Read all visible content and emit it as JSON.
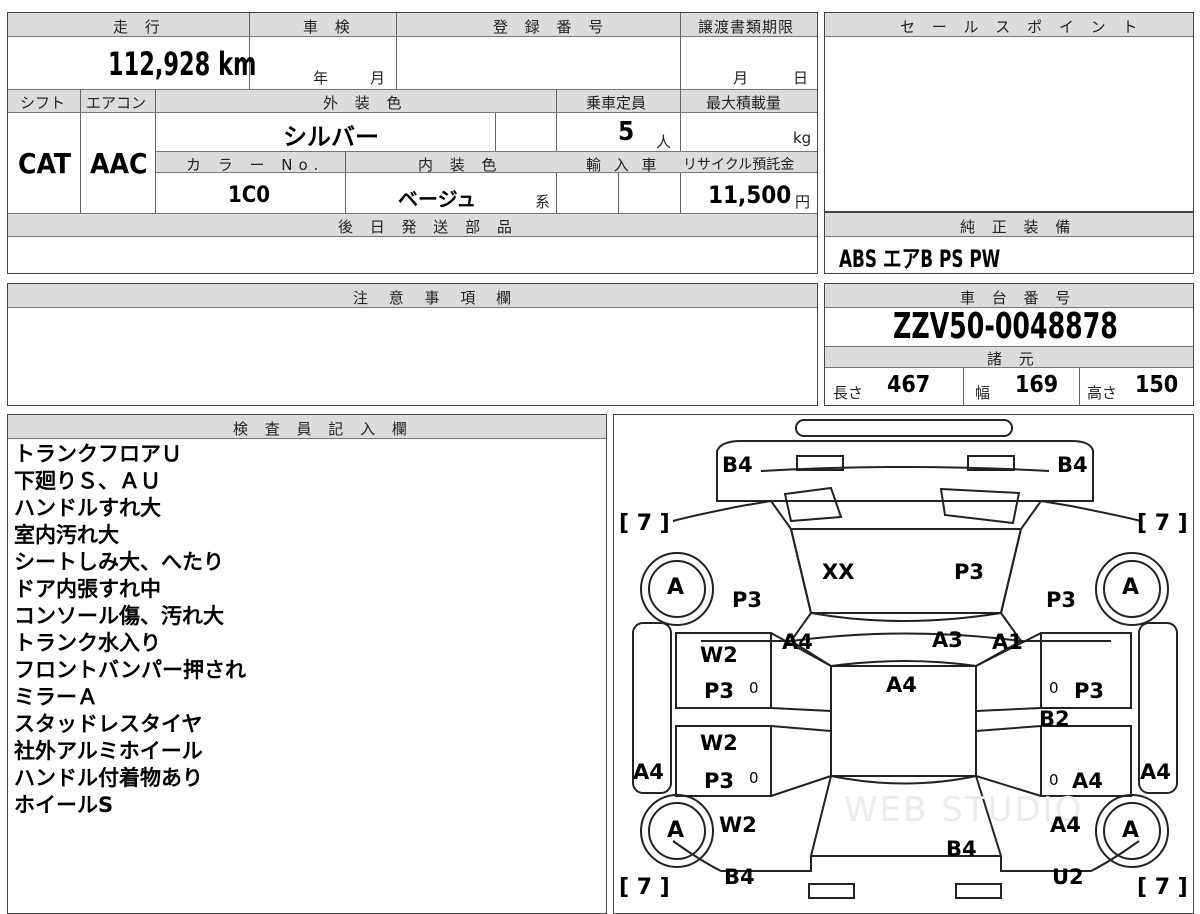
{
  "sheet": {
    "mileage": {
      "header": "走 行",
      "value": "112,928",
      "unit": "km"
    },
    "shaken": {
      "header": "車 検",
      "year": "年",
      "month": "月"
    },
    "registration": {
      "header": "登 録 番 号"
    },
    "transfer_deadline": {
      "header": "譲渡書類期限",
      "month": "月",
      "day": "日"
    },
    "shift": {
      "header": "シフト",
      "value": "CAT"
    },
    "aircon": {
      "header": "エアコン",
      "value": "AAC"
    },
    "exterior_color": {
      "header": "外 装 色",
      "value": "シルバー"
    },
    "capacity": {
      "header": "乗車定員",
      "value": "5",
      "unit": "人"
    },
    "max_load": {
      "header": "最大積載量",
      "unit": "kg"
    },
    "color_no": {
      "header": "カ ラ ー No.",
      "value": "1C0"
    },
    "interior_color": {
      "header": "内 装 色",
      "value": "ベージュ",
      "suffix": "系"
    },
    "import": {
      "header": "輸 入 車"
    },
    "recycle": {
      "header": "リサイクル預託金",
      "value": "11,500",
      "unit": "円"
    },
    "later_parts": {
      "header": "後 日 発 送 部 品"
    },
    "sales_point": {
      "header": "セ ー ル ス ポ イ ン ト"
    },
    "genuine_equipment": {
      "header": "純 正 装 備",
      "value": "ABS エアB PS PW"
    },
    "caution": {
      "header": "注 意 事 項 欄"
    },
    "chassis": {
      "header": "車 台 番 号",
      "value": "ZZV50-0048878"
    },
    "specs": {
      "header": "諸 元",
      "length_label": "長さ",
      "length": "467",
      "width_label": "幅",
      "width": "169",
      "height_label": "高さ",
      "height": "150"
    },
    "inspector": {
      "header": "検 査 員 記 入 欄",
      "notes": [
        "トランクフロアＵ",
        "下廻りＳ、ＡＵ",
        "ハンドルすれ大",
        "室内汚れ大",
        "シートしみ大、へたり",
        "ドア内張すれ中",
        "コンソール傷、汚れ大",
        "トランク水入り",
        "フロントバンパー押され",
        "ミラーＡ",
        "スタッドレスタイヤ",
        "社外アルミホイール",
        "ハンドル付着物あり",
        "ホイールS"
      ]
    },
    "diagram": {
      "tire_depth": "[ 7 ]",
      "wheel": "A",
      "marks": {
        "top_left": "B4",
        "top_right": "B4",
        "hood_left": "XX",
        "hood_right": "P3",
        "fl_fender": "P3",
        "fr_fender": "P3",
        "pillar_l": "A4",
        "pillar_c": "A3",
        "pillar_r": "A1",
        "roof": "A4",
        "l_front_door_1": "W2",
        "l_front_door_2": "P3",
        "l_rear_door_1": "W2",
        "l_rear_door_2": "P3",
        "l_side": "A4",
        "r_side": "A4",
        "r_front_door": "P3",
        "r_mid": "B2",
        "r_rear_door": "A4",
        "rl_quarter": "W2",
        "rr_quarter": "A4",
        "trunk": "B4",
        "rear_left": "B4",
        "rear_right": "U2",
        "zero": "0",
        "watermark": "WEB STUDIO"
      }
    }
  }
}
